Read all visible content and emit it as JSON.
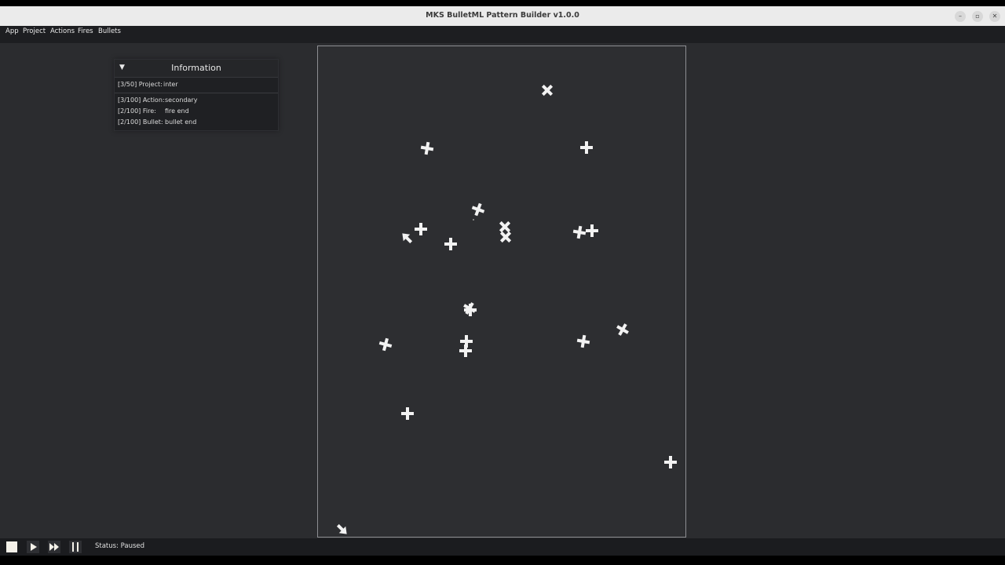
{
  "window": {
    "title": "MKS BulletML Pattern Builder v1.0.0",
    "buttons": [
      {
        "name": "minimize-button",
        "glyph": "–"
      },
      {
        "name": "maximize-button",
        "glyph": "▫"
      },
      {
        "name": "close-button",
        "glyph": "✕"
      }
    ]
  },
  "menu": {
    "items": [
      "App",
      "Project",
      "Actions",
      "Fires",
      "Bullets"
    ]
  },
  "info_panel": {
    "title": "Information",
    "collapse_glyph": "▼",
    "rows": [
      {
        "label": "[3/50] Project:",
        "value": "inter"
      },
      {
        "label": "[3/100] Action:",
        "value": "secondary"
      },
      {
        "label": "[2/100] Fire:",
        "value": "fire end"
      },
      {
        "label": "[2/100] Bullet:",
        "value": "bullet end"
      }
    ]
  },
  "playback": {
    "controls": [
      "stop",
      "play",
      "fast-forward",
      "pause"
    ],
    "status_text": "Status: Paused"
  },
  "canvas": {
    "bullet_color": "#f2f2f2",
    "background": "#2d2e31",
    "border": "#8d8e92",
    "bullet_icon": "four-pointed-star",
    "arrow_icon": "arrow"
  }
}
